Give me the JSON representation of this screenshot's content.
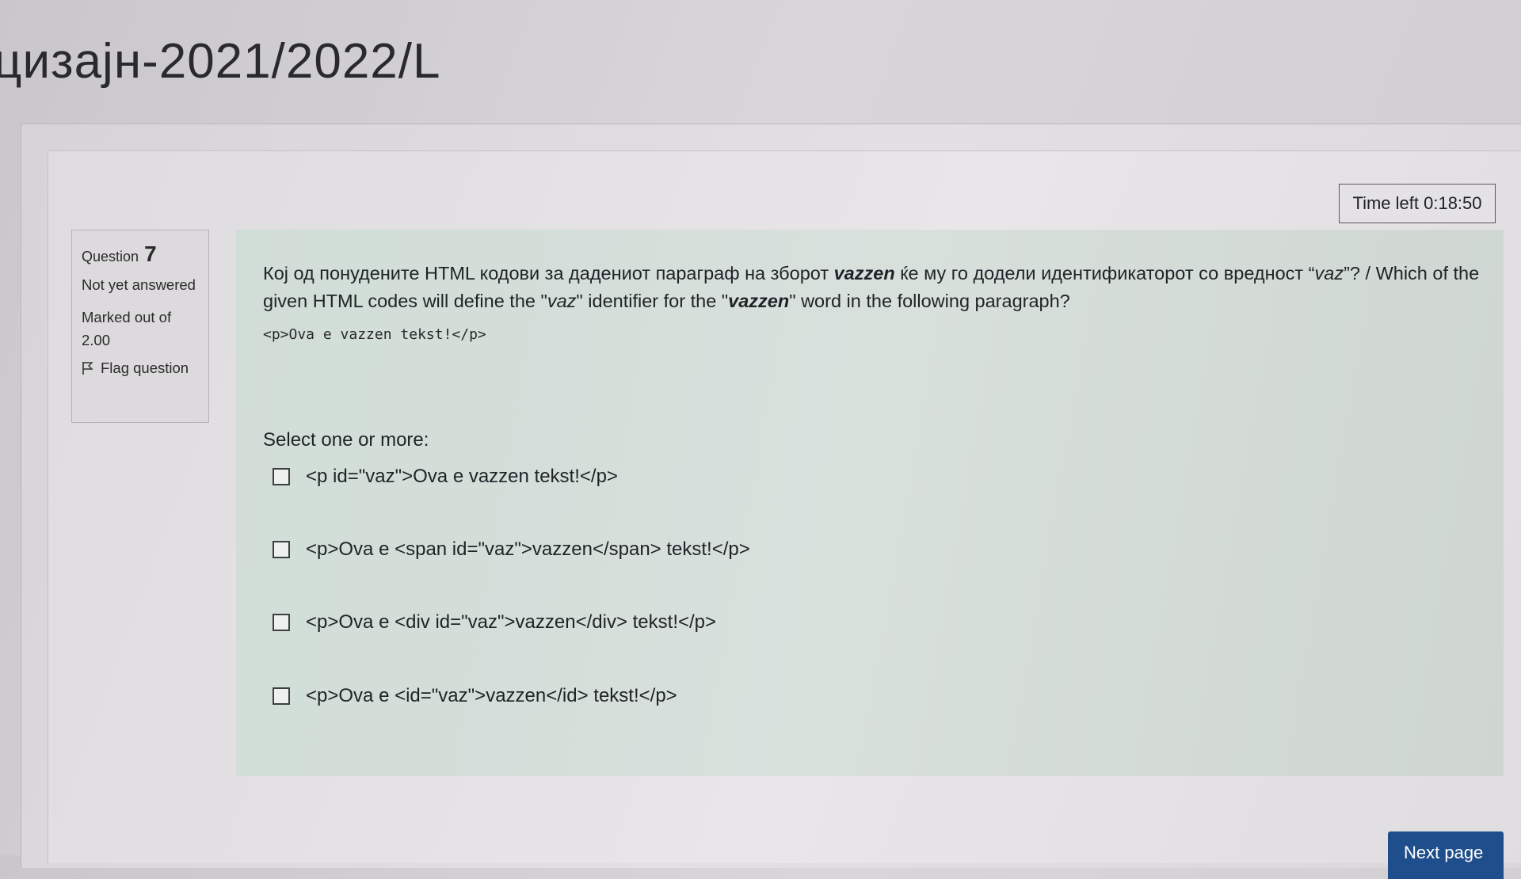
{
  "header": {
    "title": "цизајн-2021/2022/L"
  },
  "timer": {
    "label": "Time left 0:18:50"
  },
  "info": {
    "question_label": "Question",
    "question_number": "7",
    "state": "Not yet answered",
    "grade": "Marked out of 2.00",
    "flag_label": "Flag question"
  },
  "question": {
    "text_mk_prefix": "Кој од понудените HTML кодови за дадениот параграф на зборот ",
    "text_word1": "vazzen",
    "text_mk_suffix": " ќе му го додели идентификаторот со вредност “",
    "text_vaz1": "vaz",
    "text_mid": "”? / Which of the given HTML codes will define the \"",
    "text_vaz2": "vaz",
    "text_mid2": "\" identifier for the \"",
    "text_word2": "vazzen",
    "text_end": "\" word in the following paragraph?",
    "code": "<p>Ova e vazzen tekst!</p>",
    "prompt": "Select one or more:",
    "options": [
      {
        "label": "<p id=\"vaz\">Ova e vazzen tekst!</p>",
        "checked": false
      },
      {
        "label": "<p>Ova e <span id=\"vaz\">vazzen</span> tekst!</p>",
        "checked": false
      },
      {
        "label": "<p>Ova e <div id=\"vaz\">vazzen</div> tekst!</p>",
        "checked": false
      },
      {
        "label": "<p>Ova e <id=\"vaz\">vazzen</id> tekst!</p>",
        "checked": false
      }
    ]
  },
  "footer": {
    "next_label": "Next page"
  },
  "colors": {
    "panel": "#d4ddd8",
    "button": "#1f4e8c"
  }
}
